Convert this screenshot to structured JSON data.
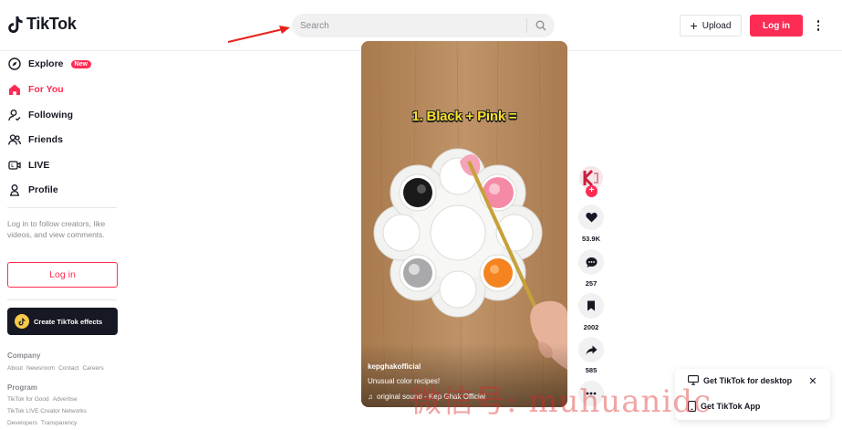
{
  "app": {
    "name": "TikTok"
  },
  "header": {
    "search_placeholder": "Search",
    "upload_label": "Upload",
    "login_label": "Log in"
  },
  "sidebar": {
    "items": [
      {
        "label": "Explore",
        "icon": "compass-icon",
        "badge": "New"
      },
      {
        "label": "For You",
        "icon": "home-icon",
        "active": true
      },
      {
        "label": "Following",
        "icon": "following-icon"
      },
      {
        "label": "Friends",
        "icon": "friends-icon"
      },
      {
        "label": "LIVE",
        "icon": "live-icon"
      },
      {
        "label": "Profile",
        "icon": "profile-icon"
      }
    ],
    "login_prompt": "Log in to follow creators, like videos, and view comments.",
    "login_label": "Log in",
    "effects_label": "Create TikTok effects",
    "footer": {
      "company_heading": "Company",
      "company_links": [
        "About",
        "Newsroom",
        "Contact",
        "Careers"
      ],
      "program_heading": "Program",
      "program_links_1": [
        "TikTok for Good",
        "Advertise"
      ],
      "program_links_2": [
        "TikTok LIVE Creator Networks"
      ],
      "program_links_3": [
        "Developers",
        "Transparency"
      ]
    }
  },
  "video": {
    "caption": "1. Black + Pink =",
    "author": "kepghakofficial",
    "description": "Unusual color recipes!",
    "sound": "original sound - Kep Ghak Official"
  },
  "actions": {
    "likes": "53.9K",
    "comments": "257",
    "saves": "2002",
    "shares": "585"
  },
  "get_app": {
    "desktop_label": "Get TikTok for desktop",
    "app_label": "Get TikTok App"
  },
  "watermark": "微信号: muhuanidc",
  "colors": {
    "brand": "#fe2c55",
    "text": "#161823",
    "muted": "#8a8b91"
  }
}
